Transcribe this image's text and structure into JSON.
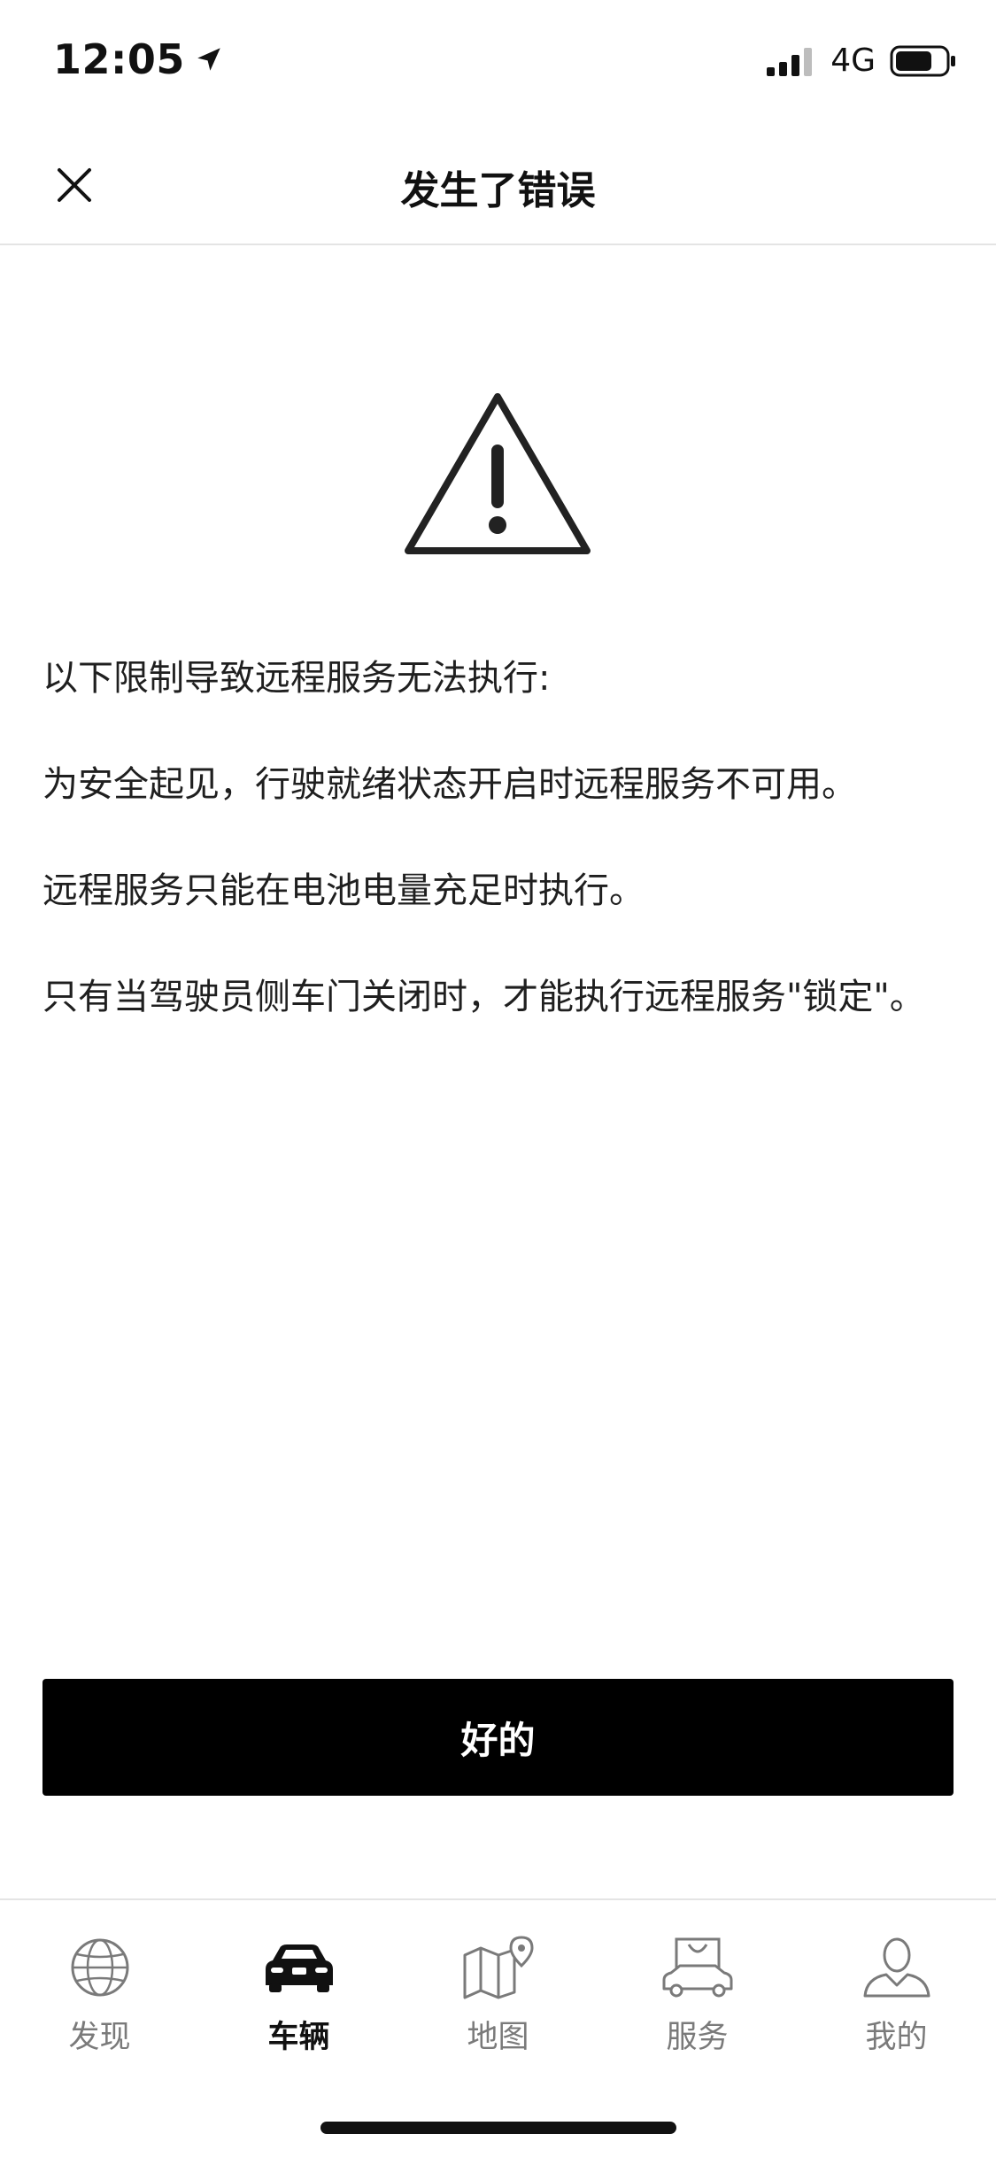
{
  "status_bar": {
    "time": "12:05",
    "network": "4G"
  },
  "header": {
    "title": "发生了错误",
    "close_icon": "close-icon"
  },
  "content": {
    "icon": "warning-triangle-icon",
    "messages": [
      "以下限制导致远程服务无法执行:",
      "为安全起见，行驶就绪状态开启时远程服务不可用。",
      "远程服务只能在电池电量充足时执行。",
      "只有当驾驶员侧车门关闭时，才能执行远程服务\"锁定\"。"
    ]
  },
  "ok_button": {
    "label": "好的"
  },
  "tab_bar": {
    "tabs": [
      {
        "label": "发现",
        "icon": "globe-icon",
        "active": false
      },
      {
        "label": "车辆",
        "icon": "car-icon",
        "active": true
      },
      {
        "label": "地图",
        "icon": "map-pin-icon",
        "active": false
      },
      {
        "label": "服务",
        "icon": "service-bag-car-icon",
        "active": false
      },
      {
        "label": "我的",
        "icon": "person-icon",
        "active": false
      }
    ]
  },
  "colors": {
    "primary_button": "#000000",
    "active_tab": "#111111",
    "inactive_tab": "#7a7a7a",
    "divider": "#e4e4e4"
  }
}
